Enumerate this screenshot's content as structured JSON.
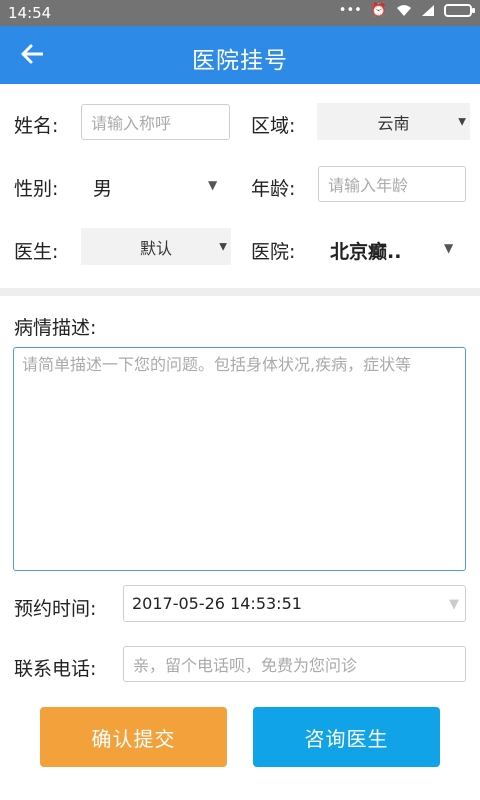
{
  "status_bar": {
    "time": "14:54",
    "icons": [
      "more-dots-icon",
      "alarm-icon",
      "wifi-icon",
      "signal-icon",
      "battery-icon"
    ]
  },
  "app_bar": {
    "back_icon": "back-arrow-icon",
    "title": "医院挂号"
  },
  "form": {
    "name": {
      "label": "姓名:",
      "placeholder": "请输入称呼"
    },
    "region": {
      "label": "区域:",
      "value": "云南"
    },
    "gender": {
      "label": "性别:",
      "value": "男"
    },
    "age": {
      "label": "年龄:",
      "placeholder": "请输入年龄"
    },
    "doctor": {
      "label": "医生:",
      "value": "默认"
    },
    "hospital": {
      "label": "医院:",
      "value": "北京癫.."
    },
    "description": {
      "label": "病情描述:",
      "placeholder": "请简单描述一下您的问题。包括身体状况,疾病，症状等"
    },
    "appointment_time": {
      "label": "预约时间:",
      "value": "2017-05-26 14:53:51"
    },
    "phone": {
      "label": "联系电话:",
      "placeholder": "亲，留个电话呗，免费为您问诊"
    }
  },
  "buttons": {
    "submit": "确认提交",
    "consult": "咨询医生"
  },
  "colors": {
    "app_bar": "#2d8ae6",
    "status_bar": "#737373",
    "submit_button": "#f3a13b",
    "consult_button": "#11a3e8",
    "textarea_border": "#4a9be8"
  }
}
